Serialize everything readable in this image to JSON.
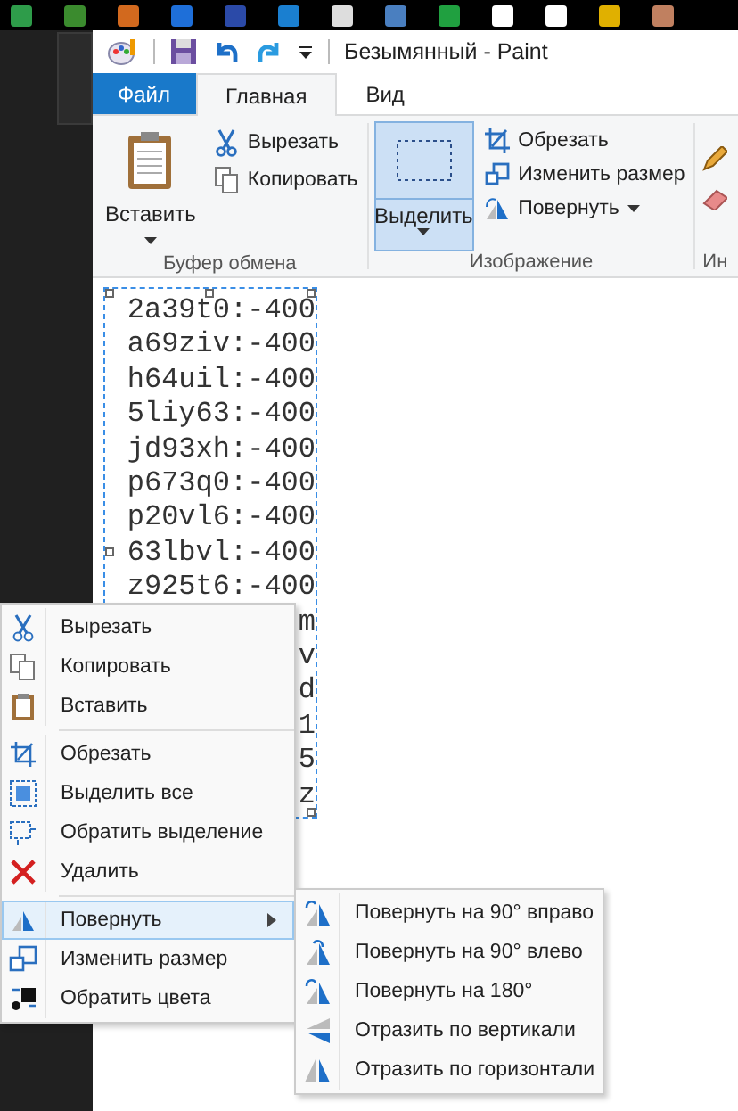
{
  "window": {
    "title": "Безымянный - Paint"
  },
  "tabs": [
    {
      "label": "Файл",
      "kind": "file",
      "selected": false
    },
    {
      "label": "Главная",
      "kind": "tab",
      "selected": true
    },
    {
      "label": "Вид",
      "kind": "tab",
      "selected": false
    }
  ],
  "ribbon": {
    "clipboard": {
      "paste": "Вставить",
      "cut": "Вырезать",
      "copy": "Копировать",
      "group_label": "Буфер обмена"
    },
    "image": {
      "select": "Выделить",
      "select_active": true,
      "crop": "Обрезать",
      "resize": "Изменить размер",
      "rotate": "Повернуть",
      "group_label": "Изображение"
    },
    "tools": {
      "group_label": "Ин"
    }
  },
  "canvas": {
    "lines": [
      "2a39t0:-400",
      "a69ziv:-400",
      "h64uil:-400",
      "5liy63:-400",
      "jd93xh:-400",
      "p673q0:-400",
      "p20vl6:-400",
      "63lbvl:-400",
      "z925t6:-400",
      "m",
      "v",
      "d",
      "1",
      "5",
      "z"
    ]
  },
  "context_menu": {
    "items": [
      {
        "label": "Вырезать",
        "divider_after": false,
        "submenu": false,
        "selected": false
      },
      {
        "label": "Копировать",
        "divider_after": false,
        "submenu": false,
        "selected": false
      },
      {
        "label": "Вставить",
        "divider_after": true,
        "submenu": false,
        "selected": false
      },
      {
        "label": "Обрезать",
        "divider_after": false,
        "submenu": false,
        "selected": false
      },
      {
        "label": "Выделить все",
        "divider_after": false,
        "submenu": false,
        "selected": false
      },
      {
        "label": "Обратить выделение",
        "divider_after": false,
        "submenu": false,
        "selected": false
      },
      {
        "label": "Удалить",
        "divider_after": true,
        "submenu": false,
        "selected": false
      },
      {
        "label": "Повернуть",
        "divider_after": false,
        "submenu": true,
        "selected": true
      },
      {
        "label": "Изменить размер",
        "divider_after": false,
        "submenu": false,
        "selected": false
      },
      {
        "label": "Обратить цвета",
        "divider_after": false,
        "submenu": false,
        "selected": false
      }
    ]
  },
  "submenu": {
    "items": [
      {
        "label": "Повернуть на 90° вправо"
      },
      {
        "label": "Повернуть на 90° влево"
      },
      {
        "label": "Повернуть на 180°"
      },
      {
        "label": "Отразить по вертикали"
      },
      {
        "label": "Отразить по горизонтали"
      }
    ]
  }
}
